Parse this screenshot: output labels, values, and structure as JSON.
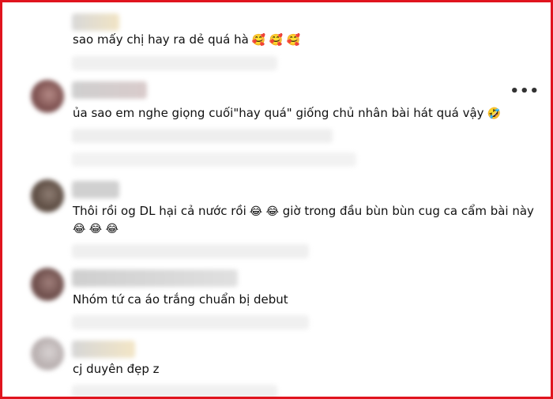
{
  "comments": [
    {
      "text": "sao mấy chị hay ra dẻ quá hà",
      "emojis": "🥰 🥰 🥰"
    },
    {
      "text": "ủa sao em nghe giọng cuối\"hay quá\" giống chủ nhân bài hát quá vậy",
      "emojis": "🤣"
    },
    {
      "text": "Thôi rồi og DL hại cả nước rồi",
      "emojis_inline": "😂 😂",
      "text_after": "giờ trong đầu bùn bùn cug ca cẩm bài này",
      "emojis_line2": "😂 😂 😂"
    },
    {
      "text": "Nhóm tứ ca áo trắng chuẩn bị debut"
    },
    {
      "text": "cj duyên đẹp z"
    }
  ],
  "more_menu": {
    "label": "•••"
  },
  "colors": {
    "frame_border": "#e0141e",
    "background": "#ffffff",
    "text": "#111111"
  },
  "icons": {
    "more": "more-options-icon"
  }
}
